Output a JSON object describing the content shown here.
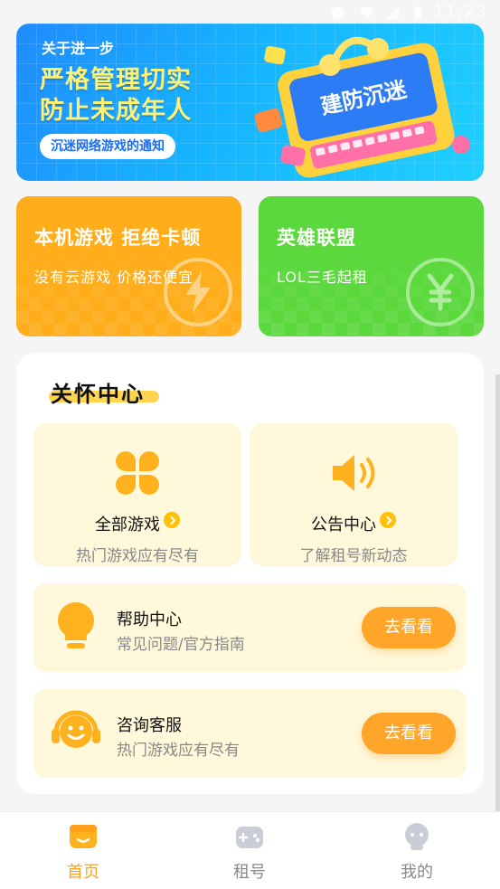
{
  "status_bar": {
    "time": "11:23"
  },
  "banner": {
    "pre_title": "关于进一步",
    "line1": "严格管理切实",
    "line2": "防止未成年人",
    "pill": "沉迷网络游戏的通知",
    "screen_text": "建防沉迷"
  },
  "cards": [
    {
      "title": "本机游戏 拒绝卡顿",
      "subtitle": "没有云游戏 价格还便宜",
      "color": "#ffad1a",
      "icon": "lightning-icon"
    },
    {
      "title": "英雄联盟",
      "subtitle": "LOL三毛起租",
      "color": "#5bd83c",
      "icon": "yen-icon"
    }
  ],
  "care_center": {
    "title": "关怀中心",
    "tiles": [
      {
        "label": "全部游戏",
        "desc": "热门游戏应有尽有",
        "icon": "clover-grid-icon"
      },
      {
        "label": "公告中心",
        "desc": "了解租号新动态",
        "icon": "speaker-icon"
      }
    ],
    "rows": [
      {
        "title": "帮助中心",
        "desc": "常见问题/官方指南",
        "button": "去看看",
        "icon": "lightbulb-icon"
      },
      {
        "title": "咨询客服",
        "desc": "热门游戏应有尽有",
        "button": "去看看",
        "icon": "headset-icon"
      }
    ]
  },
  "nav": {
    "active_color": "#ff9f1a",
    "items": [
      {
        "label": "首页",
        "icon": "home-icon",
        "active": true
      },
      {
        "label": "租号",
        "icon": "gamepad-icon",
        "active": false
      },
      {
        "label": "我的",
        "icon": "profile-icon",
        "active": false
      }
    ]
  }
}
